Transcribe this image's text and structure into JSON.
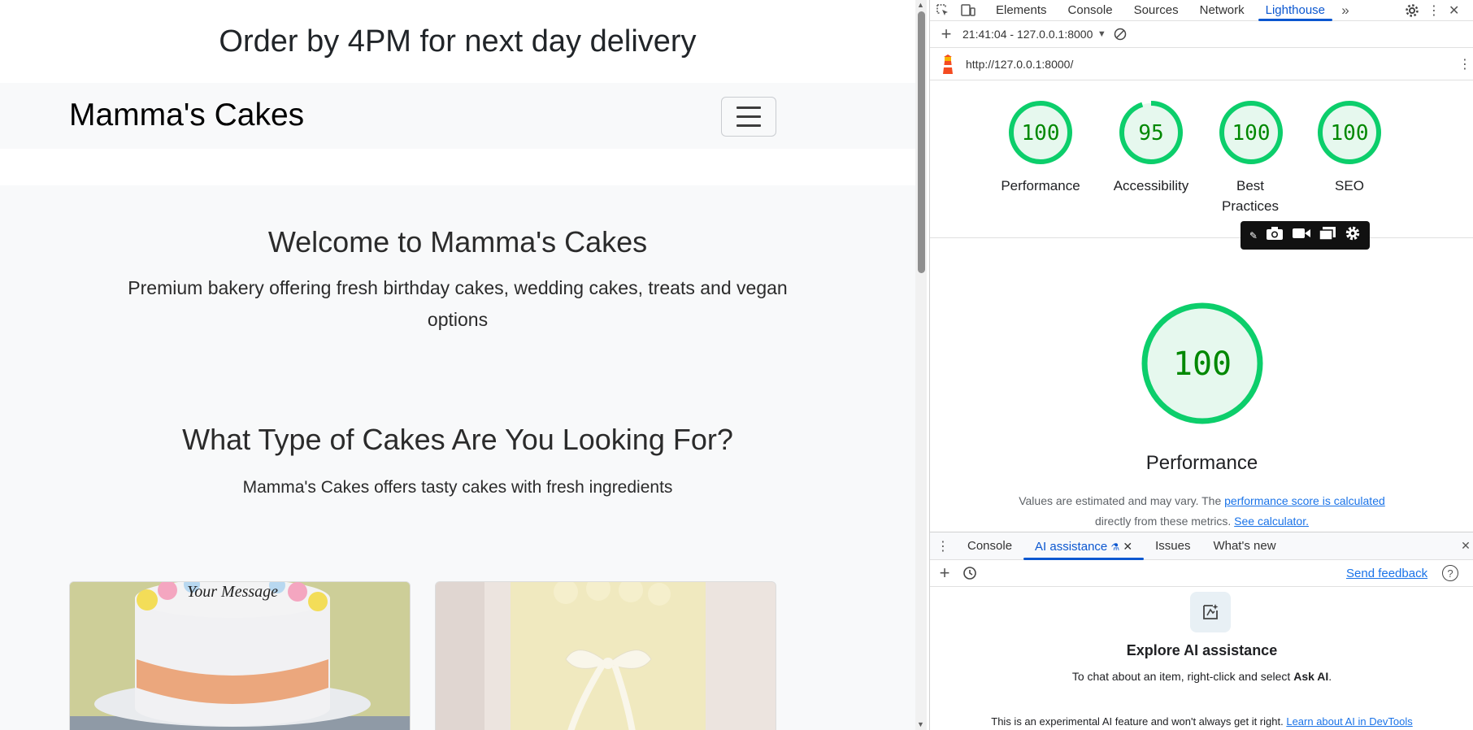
{
  "site": {
    "announcement": "Order by 4PM for next day delivery",
    "brand": "Mamma's Cakes",
    "welcome": {
      "title": "Welcome to Mamma's Cakes",
      "subtitle": "Premium bakery offering fresh birthday cakes, wedding cakes, treats and vegan options"
    },
    "cakes": {
      "title": "What Type of Cakes Are You Looking For?",
      "subtitle": "Mamma's Cakes offers tasty cakes with fresh ingredients",
      "card1_text": "Your Message"
    }
  },
  "devtools": {
    "tabs": [
      "Elements",
      "Console",
      "Sources",
      "Network",
      "Lighthouse"
    ],
    "active_tab": "Lighthouse",
    "report_selector": "21:41:04 - 127.0.0.1:8000",
    "url": "http://127.0.0.1:8000/",
    "scores": [
      {
        "value": "100",
        "label": "Performance",
        "fraction": 1.0
      },
      {
        "value": "95",
        "label": "Accessibility",
        "fraction": 0.95
      },
      {
        "value": "100",
        "label": "Best Practices",
        "fraction": 1.0
      },
      {
        "value": "100",
        "label": "SEO",
        "fraction": 1.0
      }
    ],
    "performance": {
      "score": "100",
      "title": "Performance",
      "note_prefix": "Values are estimated and may vary. The",
      "note_link": "performance score is calculated",
      "note_middle": "directly from these metrics.",
      "note_link2": "See calculator."
    },
    "drawer": {
      "tabs": [
        "Console",
        "AI assistance",
        "Issues",
        "What's new"
      ],
      "active_tab": "AI assistance",
      "send_feedback": "Send feedback",
      "ai_title": "Explore AI assistance",
      "ai_sub_prefix": "To chat about an item, right-click and select",
      "ai_sub_bold": "Ask AI",
      "ai_foot": "This is an experimental AI feature and won't always get it right.",
      "ai_foot_link": "Learn about AI in DevTools"
    },
    "colors": {
      "score_green": "#0cce6b",
      "score_fill": "#e6f8ee",
      "score_text": "#008800",
      "accent": "#0b57d0"
    }
  }
}
